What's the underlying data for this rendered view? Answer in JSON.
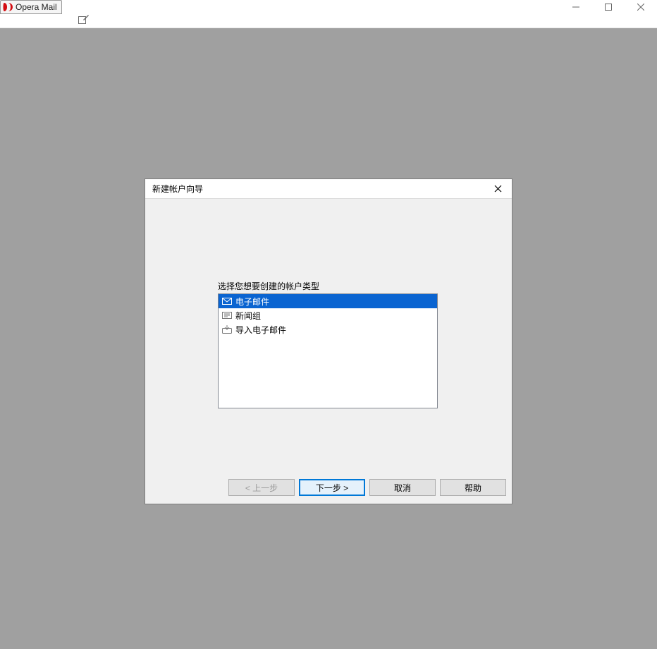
{
  "app": {
    "title": "Opera Mail"
  },
  "dialog": {
    "title": "新建帐户向导",
    "prompt": "选择您想要创建的帐户类型",
    "options": {
      "email": "电子邮件",
      "news": "新闻组",
      "import": "导入电子邮件"
    },
    "buttons": {
      "back": "< 上一步",
      "next": "下一步 >",
      "cancel": "取消",
      "help": "帮助"
    }
  }
}
